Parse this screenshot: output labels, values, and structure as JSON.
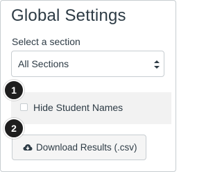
{
  "panel": {
    "title": "Global Settings",
    "section_label": "Select a section",
    "section_select": {
      "selected": "All Sections"
    },
    "hide_student_names": {
      "label": "Hide Student Names",
      "checked": false
    },
    "download_button": {
      "label": "Download Results (.csv)",
      "icon": "download-icon"
    }
  },
  "callouts": [
    "1",
    "2"
  ],
  "colors": {
    "text": "#2d3b45",
    "border": "#c7cdd1",
    "row_highlight": "#f2f2f2",
    "callout_bg": "#1e1e1e"
  }
}
